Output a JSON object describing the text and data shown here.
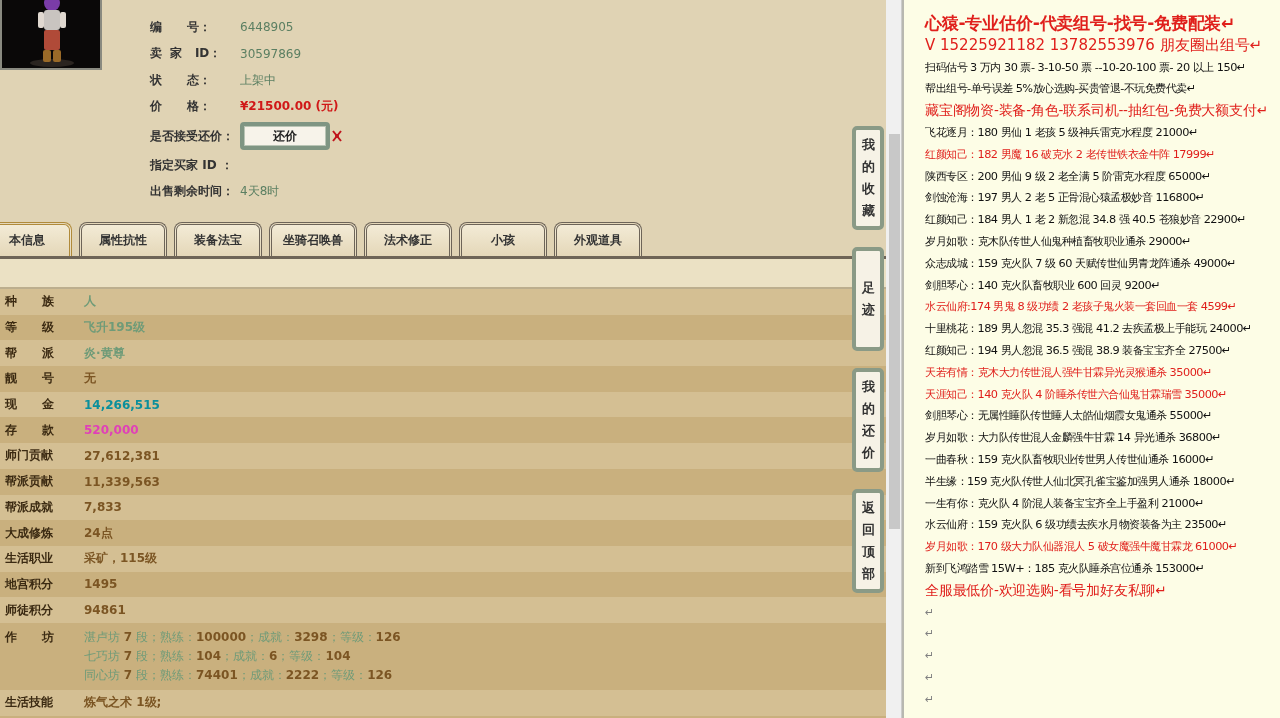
{
  "item_info": {
    "rows": [
      {
        "label": "编      号：",
        "value": "6448905",
        "kind": "text"
      },
      {
        "label": "卖  家   ID：",
        "value": "30597869",
        "kind": "text"
      },
      {
        "label": "状      态：",
        "value": "上架中",
        "kind": "text"
      },
      {
        "label": "价      格：",
        "value": "¥21500.00 (元)",
        "kind": "price"
      },
      {
        "label": "是否接受还价：",
        "value": "还价",
        "kind": "button"
      },
      {
        "label": "指定买家 ID ：",
        "kind": "text"
      },
      {
        "label": "出售剩余时间：",
        "value": "4天8时",
        "kind": "text"
      }
    ]
  },
  "tabs": [
    {
      "label": "本信息",
      "selected": true
    },
    {
      "label": "属性抗性",
      "selected": false
    },
    {
      "label": "装备法宝",
      "selected": false
    },
    {
      "label": "坐骑召唤兽",
      "selected": false
    },
    {
      "label": "法术修正",
      "selected": false
    },
    {
      "label": "小孩",
      "selected": false
    },
    {
      "label": "外观道具",
      "selected": false
    }
  ],
  "attributes": [
    {
      "kind": "single",
      "label": "种      族",
      "value": "人",
      "color": "#6f9b78"
    },
    {
      "kind": "single",
      "label": "等      级",
      "value": "飞升195级",
      "color": "#6f9b78"
    },
    {
      "kind": "single",
      "label": "帮      派",
      "value": "炎·黄尊",
      "color": "#6f9b78"
    },
    {
      "kind": "single",
      "label": "靓      号",
      "value": "无",
      "color": "#7b5523"
    },
    {
      "kind": "single",
      "label": "现      金",
      "value": "14,266,515",
      "color": "#0a8f9c"
    },
    {
      "kind": "single",
      "label": "存      款",
      "value": "520,000",
      "color": "#e040b8"
    },
    {
      "kind": "single",
      "label": "师门贡献",
      "value": "27,612,381",
      "color": "#7b5523"
    },
    {
      "kind": "single",
      "label": "帮派贡献",
      "value": "11,339,563",
      "color": "#7b5523"
    },
    {
      "kind": "single",
      "label": "帮派成就",
      "value": "7,833",
      "color": "#7b5523"
    },
    {
      "kind": "single",
      "label": "大成修炼",
      "value": "24点",
      "color": "#7b5523"
    },
    {
      "kind": "single",
      "label": "生活职业",
      "value": "采矿，115级",
      "color": "#7b5523"
    },
    {
      "kind": "single",
      "label": "地宫积分",
      "value": "1495",
      "color": "#7b5523"
    },
    {
      "kind": "single",
      "label": "师徒积分",
      "value": "94861",
      "color": "#7b5523"
    },
    {
      "kind": "multi",
      "label": "作      坊",
      "lines": [
        "湛卢坊 **7** 段；熟练：**100000**；成就：**3298**；等级：**126**",
        "七巧坊 **7** 段；熟练：**104**；成就：**6**；等级：**104**",
        "同心坊 **7** 段；熟练：**74401**；成就：**2222**；等级：**126**"
      ],
      "color": "#6f9b78"
    },
    {
      "kind": "single",
      "label": "生活技能",
      "value": "炼气之术 1级;",
      "color": "#7b5523"
    }
  ],
  "side_buttons": [
    {
      "label": "我的收藏"
    },
    {
      "label": "足迹"
    },
    {
      "label": "我的还价"
    },
    {
      "label": "返回顶部"
    }
  ],
  "document": {
    "lines": [
      {
        "kind": "title",
        "text": "心猿-专业估价-代卖组号-找号-免费配装↵",
        "color": "#e0201c"
      },
      {
        "kind": "large",
        "text": "V 15225921182   13782553976 朋友圈出组号↵",
        "color": "#e0201c"
      },
      {
        "kind": "normal",
        "text": "扫码估号 3 万内 30 票- 3-10-50 票  --10-20-100 票- 20 以上 150↵",
        "color": "#111111"
      },
      {
        "kind": "normal",
        "text": "帮出组号-单号误差 5%放心选购-买贵管退-不玩免费代卖↵",
        "color": "#111111"
      },
      {
        "kind": "medium",
        "text": "藏宝阁物资-装备-角色-联系司机--抽红包-免费大额支付↵",
        "color": "#e0201c"
      },
      {
        "kind": "normal",
        "text": "飞花逐月：180 男仙 1 老孩 5 级神兵雷克水程度 21000↵",
        "color": "#111111"
      },
      {
        "kind": "normal",
        "text": "红颜知己：182 男魔 16 破克水 2 老传世铁衣金牛阵 17999↵",
        "color": "#e0201c"
      },
      {
        "kind": "normal",
        "text": "陕西专区：200 男仙 9 级 2 老全满 5 阶雷克水程度 65000↵",
        "color": "#111111"
      },
      {
        "kind": "normal",
        "text": "剑蚀沧海：197 男人 2 老 5 正骨混心猿孟极妙音 116800↵",
        "color": "#111111"
      },
      {
        "kind": "normal",
        "text": "红颜知己：184 男人 1 老 2 新忽混 34.8 强 40.5 苍狼妙音 22900↵",
        "color": "#111111"
      },
      {
        "kind": "normal",
        "text": "岁月如歌：克木队传世人仙鬼种植畜牧职业通杀 29000↵",
        "color": "#111111"
      },
      {
        "kind": "normal",
        "text": "众志成城：159 克火队 7 级 60 天赋传世仙男青龙阵通杀 49000↵",
        "color": "#111111"
      },
      {
        "kind": "normal",
        "text": "剑胆琴心：140 克火队畜牧职业 600 回灵 9200↵",
        "color": "#111111"
      },
      {
        "kind": "normal",
        "text": "水云仙府:174 男鬼 8 级功绩 2 老孩子鬼火装一套回血一套 4599↵",
        "color": "#e0201c"
      },
      {
        "kind": "normal",
        "text": "十里桃花：189 男人忽混 35.3 强混 41.2 去疾孟极上手能玩 24000↵",
        "color": "#111111"
      },
      {
        "kind": "normal",
        "text": "红颜知己：194 男人忽混 36.5 强混 38.9 装备宝宝齐全 27500↵",
        "color": "#111111"
      },
      {
        "kind": "normal",
        "text": "天若有情：克木大力传世混人强牛甘霖异光灵猴通杀 35000↵",
        "color": "#e0201c"
      },
      {
        "kind": "normal",
        "text": "天涯知己：140 克火队 4 阶睡杀传世六合仙鬼甘霖瑞雪 35000↵",
        "color": "#e0201c"
      },
      {
        "kind": "normal",
        "text": "剑胆琴心：无属性睡队传世睡人太皓仙烟霞女鬼通杀 55000↵",
        "color": "#111111"
      },
      {
        "kind": "normal",
        "text": "岁月如歌：大力队传世混人金麟强牛甘霖 14 异光通杀 36800↵",
        "color": "#111111"
      },
      {
        "kind": "normal",
        "text": "一曲春秋：159 克火队畜牧职业传世男人传世仙通杀 16000↵",
        "color": "#111111"
      },
      {
        "kind": "normal",
        "text": "半生缘：159 克火队传世人仙北冥孔雀宝鉴加强男人通杀 18000↵",
        "color": "#111111"
      },
      {
        "kind": "normal",
        "text": "一生有你：克火队 4 阶混人装备宝宝齐全上手盈利 21000↵",
        "color": "#111111"
      },
      {
        "kind": "normal",
        "text": "水云仙府：159 克火队 6 级功绩去疾水月物资装备为主 23500↵",
        "color": "#111111"
      },
      {
        "kind": "normal",
        "text": "岁月如歌：170 级大力队仙器混人 5 破女魔强牛魔甘霖龙 61000↵",
        "color": "#e0201c"
      },
      {
        "kind": "normal",
        "text": "新到飞鸿踏雪 15W+：185 克火队睡杀宫位通杀 153000↵",
        "color": "#111111"
      },
      {
        "kind": "medium",
        "text": "全服最低价-欢迎选购-看号加好友私聊↵",
        "color": "#e0201c"
      },
      {
        "kind": "mark",
        "text": "↵"
      },
      {
        "kind": "mark",
        "text": "↵"
      },
      {
        "kind": "mark",
        "text": "↵"
      },
      {
        "kind": "mark",
        "text": "↵"
      },
      {
        "kind": "mark",
        "text": "↵"
      }
    ]
  }
}
